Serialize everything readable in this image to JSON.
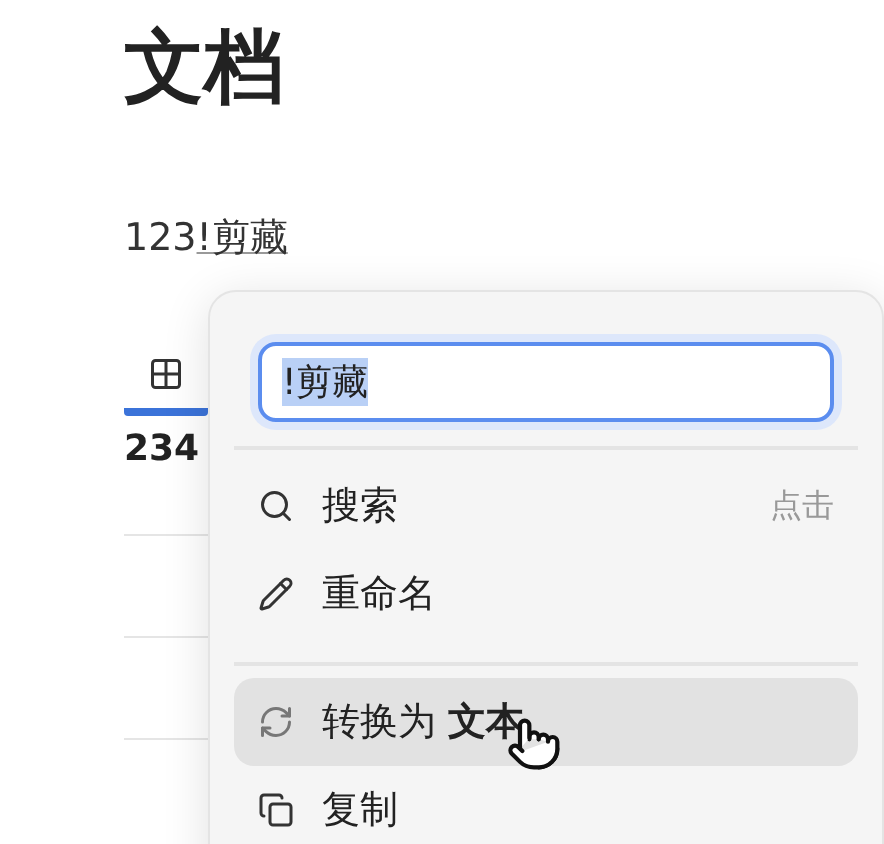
{
  "page": {
    "title": "文档",
    "paragraph": {
      "text": "123",
      "link": "!剪藏"
    }
  },
  "view_tabs": [
    {
      "kind": "table",
      "selected": true
    }
  ],
  "table": {
    "cells": [
      "234"
    ]
  },
  "menu": {
    "input": {
      "value": "!剪藏",
      "text_selected": true
    },
    "sections": [
      [
        {
          "kind": "search",
          "label": "搜索",
          "shortcut": "点击",
          "highlighted": false
        },
        {
          "kind": "rename",
          "label": "重命名",
          "highlighted": false
        }
      ],
      [
        {
          "kind": "convert",
          "label": "转换为 **文本**",
          "highlighted": true
        },
        {
          "kind": "copy",
          "label": "复制",
          "highlighted": false
        }
      ]
    ]
  }
}
